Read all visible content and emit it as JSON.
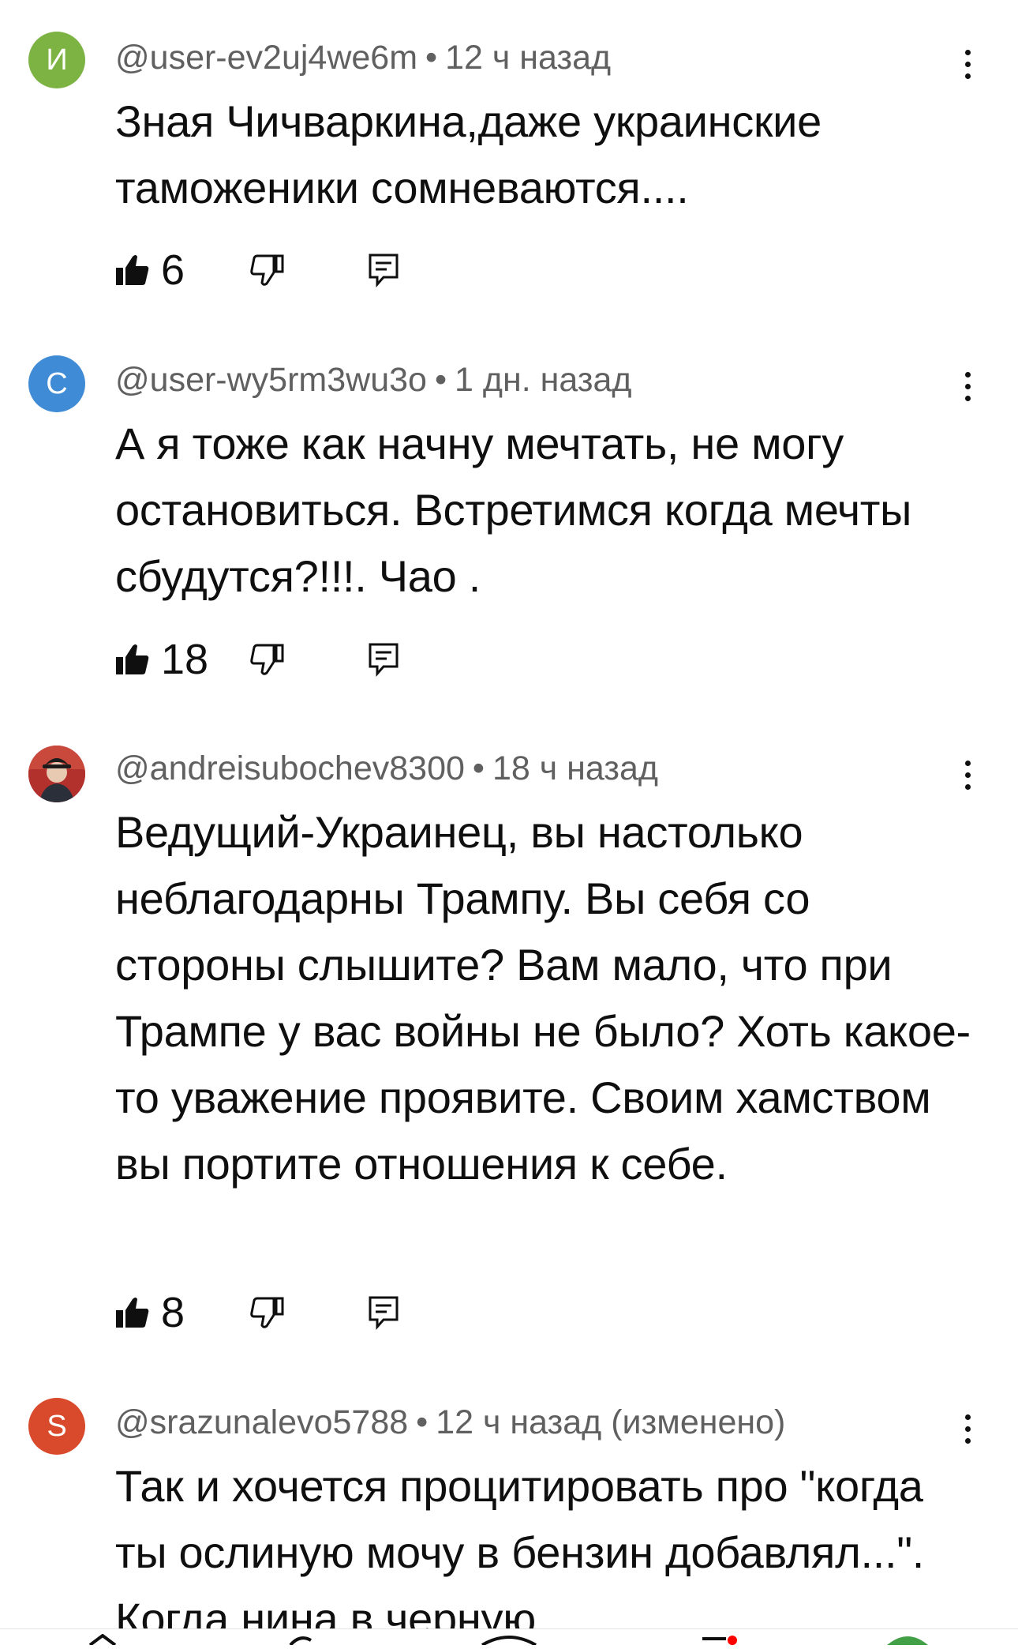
{
  "comments": [
    {
      "avatar_letter": "И",
      "avatar_color": "#7cb342",
      "author": "@user-ev2uj4we6m",
      "time": "12 ч назад",
      "text": "Зная Чичваркина,даже украинские таможеники сомневаются....",
      "likes": "6"
    },
    {
      "avatar_letter": "С",
      "avatar_color": "#3f8bd6",
      "author": "@user-wy5rm3wu3o",
      "time": "1 дн. назад",
      "text": "А я тоже как начну мечтать, не могу остановиться. Встретимся когда мечты сбудутся?!!!. Чао .",
      "likes": "18"
    },
    {
      "avatar_letter": "",
      "avatar_color": "#b3312d",
      "author": "@andreisubochev8300",
      "time": "18 ч назад",
      "text": "Ведущий-Украинец, вы настолько неблагодарны Трампу. Вы себя со стороны слышите? Вам мало, что при Трампе у вас войны не было? Хоть какое-то уважение проявите. Своим хамством вы портите отношения к себе.",
      "likes": "8"
    },
    {
      "avatar_letter": "S",
      "avatar_color": "#d84a2b",
      "author": "@srazunalevo5788",
      "time": "12 ч назад (изменено)",
      "text": "Так и хочется процитировать про \"когда ты ослиную мочу в бензин добавлял...\". Когда нина в черную",
      "likes": ""
    }
  ],
  "meta_separator": "•"
}
